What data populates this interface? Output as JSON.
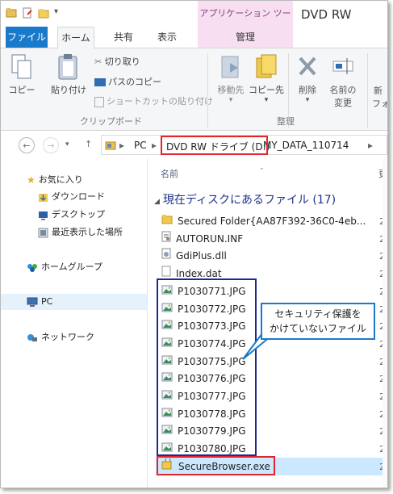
{
  "window": {
    "context_tab": "アプリケーション ツール",
    "title": "DVD RW"
  },
  "tabs": {
    "file": "ファイル",
    "home": "ホーム",
    "share": "共有",
    "view": "表示",
    "manage": "管理"
  },
  "ribbon": {
    "copy": "コピー",
    "paste": "貼り付け",
    "cut": "切り取り",
    "copy_path": "パスのコピー",
    "paste_shortcut": "ショートカットの貼り付け",
    "clipboard_group": "クリップボード",
    "move_to": "移動先",
    "copy_to": "コピー先",
    "delete": "削除",
    "rename_line1": "名前の",
    "rename_line2": "変更",
    "organize_group": "整理",
    "new_partial_1": "新",
    "new_partial_2": "フォ"
  },
  "address": {
    "pc": "PC",
    "drive": "DVD RW ドライブ (D:)",
    "folder": "MY_DATA_110714"
  },
  "nav": {
    "favorites": "お気に入り",
    "downloads": "ダウンロード",
    "desktop": "デスクトップ",
    "recent": "最近表示した場所",
    "homegroup": "ホームグループ",
    "pc": "PC",
    "network": "ネットワーク"
  },
  "files": {
    "column_name": "名前",
    "column_date_partial": "更",
    "group_header": "現在ディスクにあるファイル (17)",
    "items": [
      {
        "name": "Secured Folder{AA87F392-36C0-4eb...",
        "date": "2"
      },
      {
        "name": "AUTORUN.INF",
        "date": "2"
      },
      {
        "name": "GdiPlus.dll",
        "date": "2"
      },
      {
        "name": "Index.dat",
        "date": "2"
      },
      {
        "name": "P1030771.JPG",
        "date": "2"
      },
      {
        "name": "P1030772.JPG",
        "date": "2"
      },
      {
        "name": "P1030773.JPG",
        "date": "2"
      },
      {
        "name": "P1030774.JPG",
        "date": "2"
      },
      {
        "name": "P1030775.JPG",
        "date": "2"
      },
      {
        "name": "P1030776.JPG",
        "date": "2"
      },
      {
        "name": "P1030777.JPG",
        "date": "2"
      },
      {
        "name": "P1030778.JPG",
        "date": "2"
      },
      {
        "name": "P1030779.JPG",
        "date": "2"
      },
      {
        "name": "P1030780.JPG",
        "date": "2"
      },
      {
        "name": "SecureBrowser.exe",
        "date": "2"
      }
    ]
  },
  "callout": {
    "line1": "セキュリティ保護を",
    "line2": "かけていないファイル"
  },
  "colors": {
    "file_tab": "#1979ca",
    "context_tab_bg": "#f7dff1",
    "annotation_red": "#e2262f",
    "annotation_blue": "#1f2a8f",
    "callout_border": "#1a7ac8",
    "selection": "#cce8ff"
  }
}
